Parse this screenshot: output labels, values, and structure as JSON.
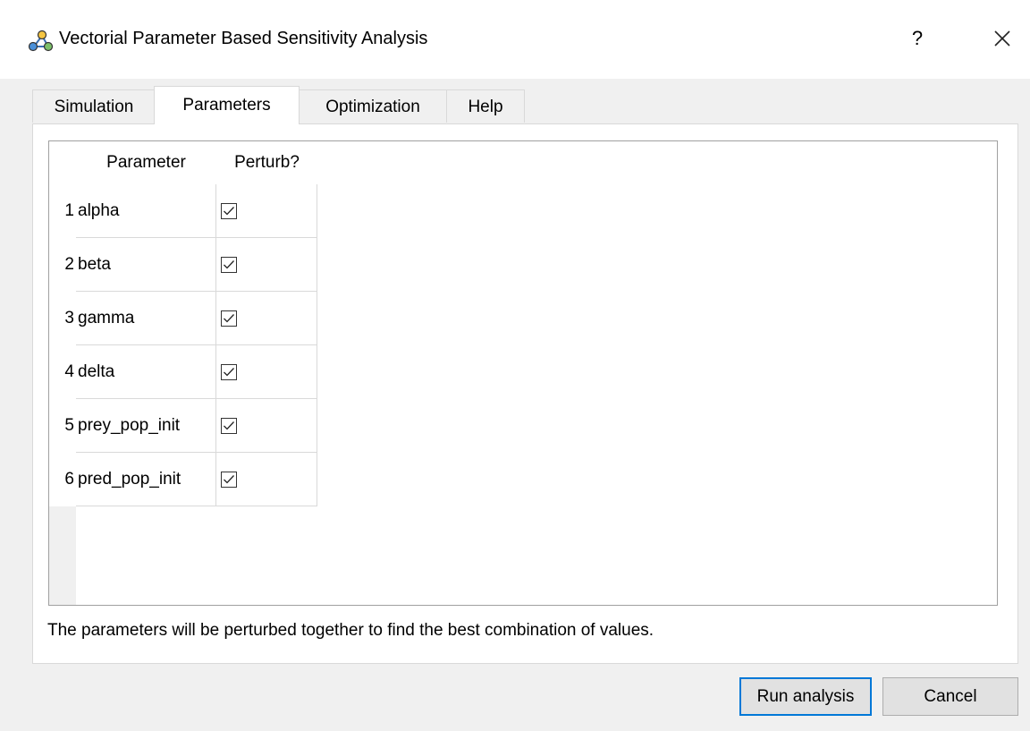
{
  "window": {
    "title": "Vectorial Parameter Based Sensitivity Analysis",
    "help_label": "?",
    "icon": "app-network-icon",
    "close_icon": "close-icon"
  },
  "tabs": [
    {
      "label": "Simulation",
      "active": false
    },
    {
      "label": "Parameters",
      "active": true
    },
    {
      "label": "Optimization",
      "active": false
    },
    {
      "label": "Help",
      "active": false
    }
  ],
  "table": {
    "columns": [
      "Parameter",
      "Perturb?"
    ],
    "rows": [
      {
        "num": "1",
        "name": "alpha",
        "perturb": true
      },
      {
        "num": "2",
        "name": "beta",
        "perturb": true
      },
      {
        "num": "3",
        "name": "gamma",
        "perturb": true
      },
      {
        "num": "4",
        "name": "delta",
        "perturb": true
      },
      {
        "num": "5",
        "name": "prey_pop_init",
        "perturb": true
      },
      {
        "num": "6",
        "name": "pred_pop_init",
        "perturb": true
      }
    ]
  },
  "info_text": "The parameters will be perturbed together to find the best combination of values.",
  "buttons": {
    "run": "Run analysis",
    "cancel": "Cancel"
  },
  "colors": {
    "accent": "#0078d7",
    "window_bg": "#f0f0f0",
    "panel_bg": "#ffffff"
  }
}
